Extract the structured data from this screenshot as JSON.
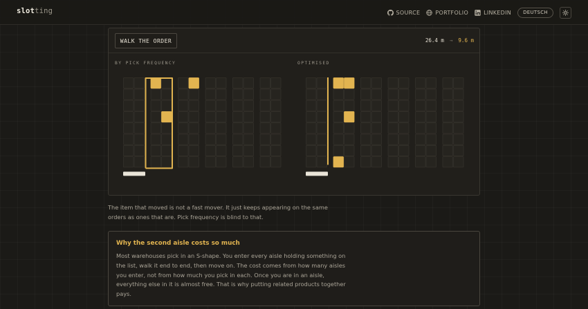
{
  "header": {
    "logo_main": "slot",
    "logo_dim": "ting",
    "nav": [
      {
        "label": "SOURCE",
        "icon": "github-icon"
      },
      {
        "label": "PORTFOLIO",
        "icon": "globe-icon"
      },
      {
        "label": "LINKEDIN",
        "icon": "linkedin-icon"
      }
    ],
    "language_button": "DEUTSCH",
    "theme_icon": "sun-icon"
  },
  "panel": {
    "walk_button": "WALK THE ORDER",
    "distance_before": "26.4 m",
    "arrow": "→",
    "distance_after": "9.6 m",
    "layouts": [
      {
        "label": "BY PICK FREQUENCY",
        "highlights": [
          [
            1,
            0,
            0
          ],
          [
            1,
            1,
            3
          ],
          [
            1,
            2,
            0
          ],
          [
            1,
            3,
            3
          ],
          [
            2,
            1,
            0
          ]
        ],
        "route": "aisles 1 and 2"
      },
      {
        "label": "OPTIMISED",
        "highlights": [
          [
            1,
            0,
            0
          ],
          [
            1,
            1,
            3
          ],
          [
            1,
            0,
            7
          ],
          [
            1,
            1,
            0
          ]
        ],
        "route": "aisle 1"
      }
    ]
  },
  "description": "The item that moved is not a fast mover. It just keeps appearing on the same orders as ones that are. Pick frequency is blind to that.",
  "callout": {
    "title": "Why the second aisle costs so much",
    "text": "Most warehouses pick in an S-shape. You enter every aisle holding something on the list, walk it end to end, then move on. The cost comes from how many aisles you enter, not from how much you pick in each. Once you are in an aisle, everything else in it is almost free. That is why putting related products together pays."
  },
  "colors": {
    "accent": "#e2b450",
    "background": "#1b1a17",
    "panel": "#211f1b",
    "rack": "#34312b"
  }
}
